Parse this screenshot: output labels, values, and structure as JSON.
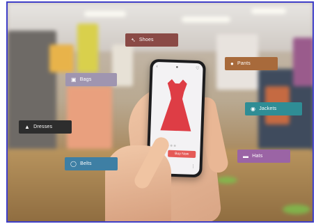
{
  "tags": {
    "shoes": {
      "label": "Shoes",
      "icon": "shoe-icon",
      "color": "#8a4a46"
    },
    "pants": {
      "label": "Pants",
      "icon": "bulb-icon",
      "color": "#a86a3b"
    },
    "bags": {
      "label": "Bags",
      "icon": "bag-icon",
      "color": "#9f95b0"
    },
    "jackets": {
      "label": "Jackets",
      "icon": "jacket-icon",
      "color": "#2f8d95"
    },
    "dresses": {
      "label": "Dresses",
      "icon": "person-icon",
      "color": "#2d2d2d"
    },
    "belts": {
      "label": "Belts",
      "icon": "belt-icon",
      "color": "#3e7fa4"
    },
    "hats": {
      "label": "Hats",
      "icon": "hat-icon",
      "color": "#9b64a5"
    }
  },
  "phone": {
    "product_color": "#de3d45",
    "button_label": "Buy Now"
  },
  "frame_color": "#3e3ec8"
}
